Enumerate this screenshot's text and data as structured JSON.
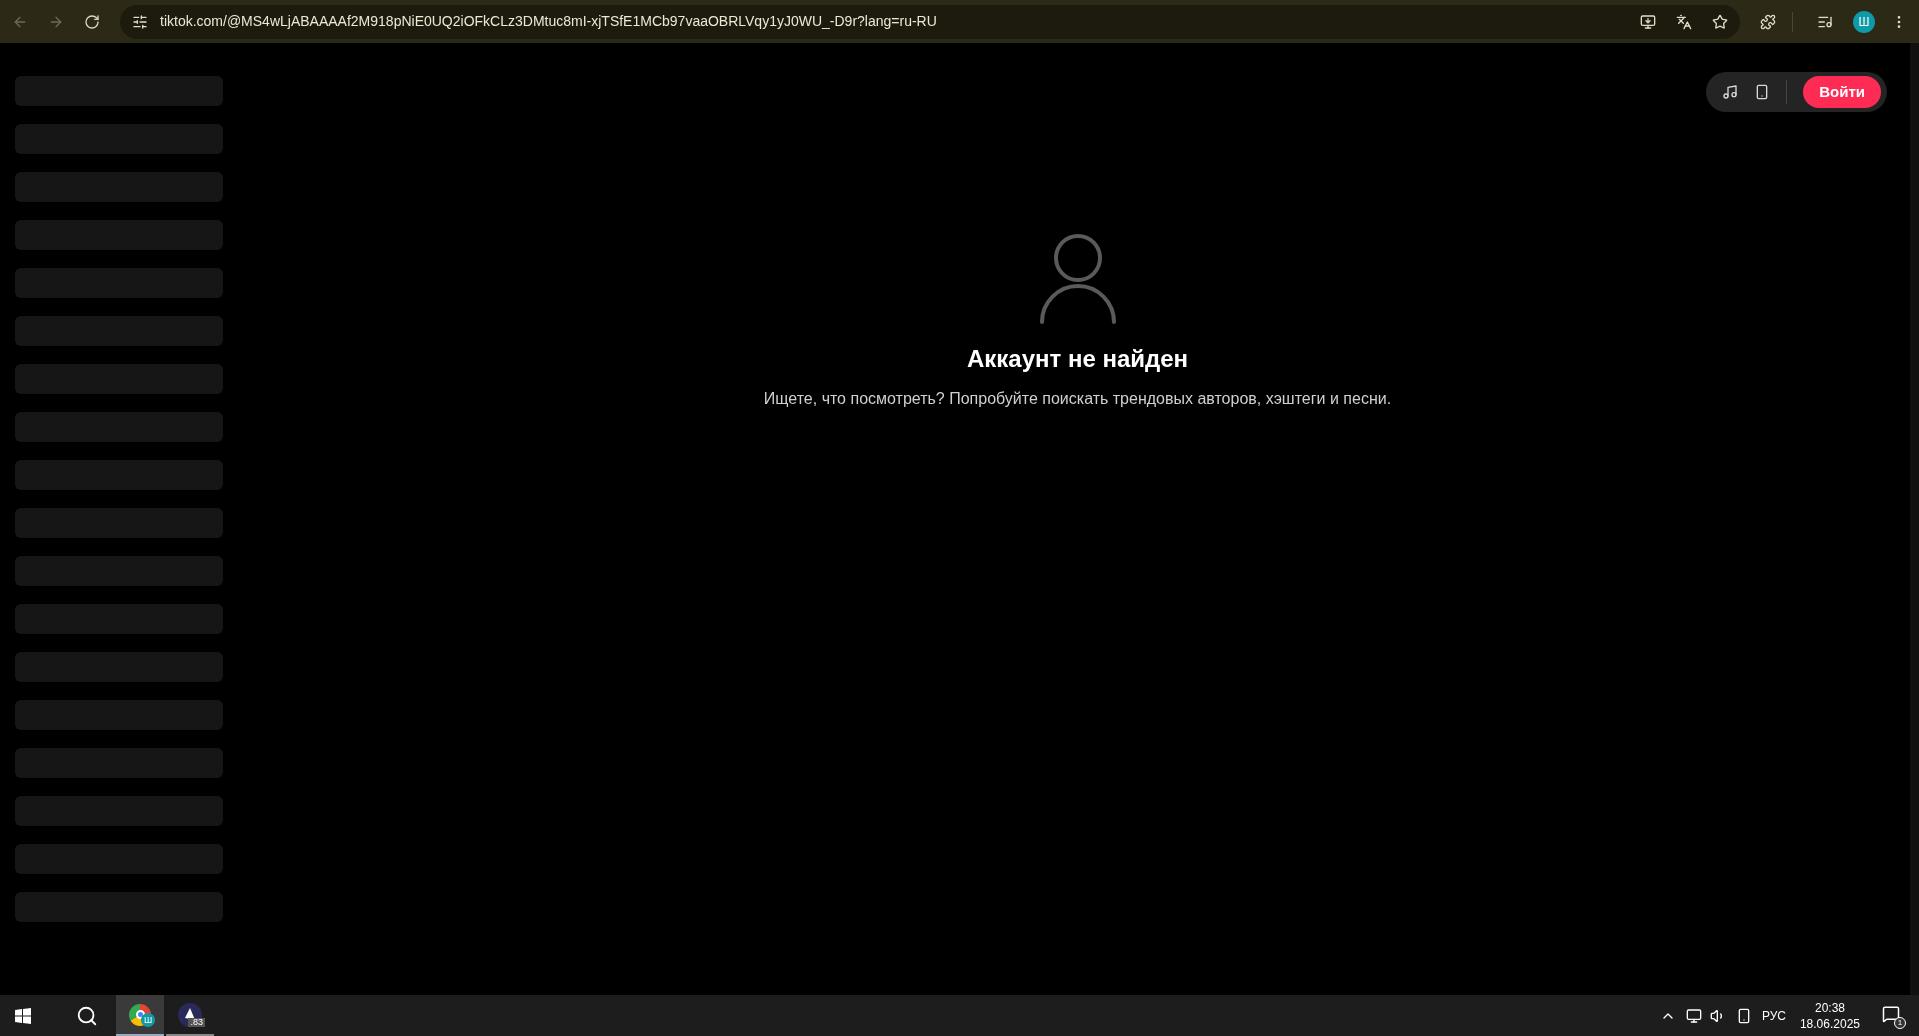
{
  "browser": {
    "address": "tiktok.com/@MS4wLjABAAAAf2M918pNiE0UQ2iOFkCLz3DMtuc8mI-xjTSfE1MCb97vaaOBRLVqy1yJ0WU_-D9r?lang=ru-RU",
    "profile_initial": "Ш"
  },
  "header": {
    "login_button": "Войти"
  },
  "empty_state": {
    "title": "Аккаунт не найден",
    "message": "Ищете, что посмотреть? Попробуйте поискать трендовых авторов, хэштеги и песни."
  },
  "taskbar": {
    "apps": [
      {
        "kind": "browser",
        "badge": "Ш",
        "selected": true
      },
      {
        "kind": "app",
        "badge": ".83",
        "selected": false
      }
    ],
    "language": "РУС",
    "time": "20:38",
    "date": "18.06.2025",
    "notifications": "1"
  }
}
